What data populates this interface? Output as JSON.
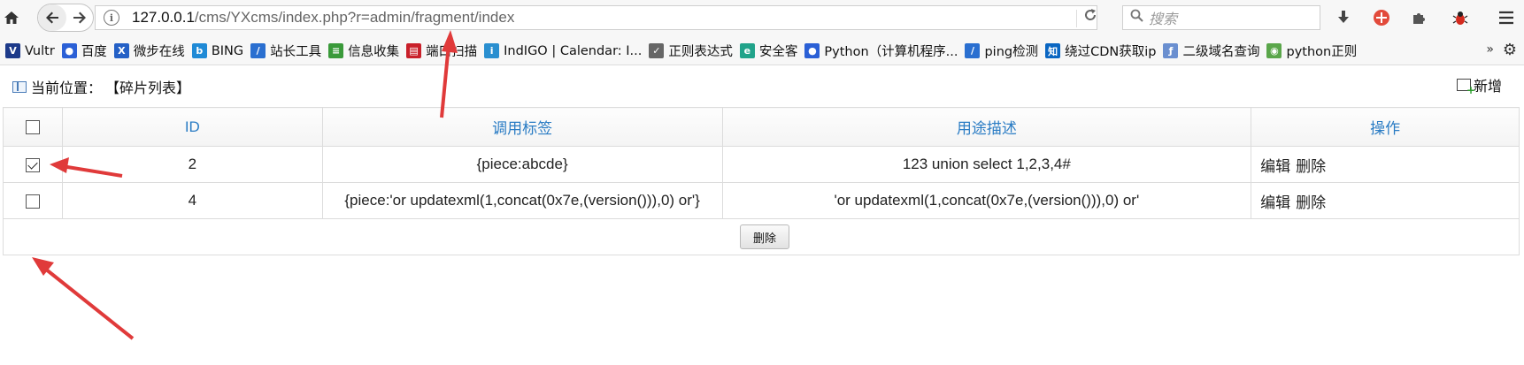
{
  "browser": {
    "url_host": "127.0.0.1",
    "url_path": "/cms/YXcms/index.php?r=admin/fragment/index",
    "search_placeholder": "搜索"
  },
  "bookmarks": [
    {
      "label": "Vultr",
      "icon": "vultr-icon",
      "icon_text": "V",
      "color": "#1d3a8a"
    },
    {
      "label": "百度",
      "icon": "baidu-paw-icon",
      "icon_text": "●",
      "color": "#2b60d6"
    },
    {
      "label": "微步在线",
      "icon": "threatbook-icon",
      "icon_text": "X",
      "color": "#2460c6"
    },
    {
      "label": "BING",
      "icon": "bing-icon",
      "icon_text": "b",
      "color": "#1f8ad6"
    },
    {
      "label": "站长工具",
      "icon": "chinaz-icon",
      "icon_text": "/",
      "color": "#2a6fd0"
    },
    {
      "label": "信息收集",
      "icon": "bars-icon",
      "icon_text": "≡",
      "color": "#3a9a3a"
    },
    {
      "label": "端口扫描",
      "icon": "port-scan-icon",
      "icon_text": "▤",
      "color": "#c9202a"
    },
    {
      "label": "IndIGO | Calendar: I...",
      "icon": "indigo-icon",
      "icon_text": "i",
      "color": "#2a8fd0"
    },
    {
      "label": "正则表达式",
      "icon": "regex-icon",
      "icon_text": "✓",
      "color": "#666666"
    },
    {
      "label": "安全客",
      "icon": "anquanke-icon",
      "icon_text": "e",
      "color": "#21a38a"
    },
    {
      "label": "Python（计算机程序...",
      "icon": "paw-icon",
      "icon_text": "●",
      "color": "#2b60d6"
    },
    {
      "label": "ping检测",
      "icon": "ping-icon",
      "icon_text": "/",
      "color": "#2a6fd0"
    },
    {
      "label": "绕过CDN获取ip",
      "icon": "zhihu-icon",
      "icon_text": "知",
      "color": "#0a66c2"
    },
    {
      "label": "二级域名查询",
      "icon": "subdomain-icon",
      "icon_text": "ƒ",
      "color": "#6a8fd0"
    },
    {
      "label": "python正则",
      "icon": "python-regex-icon",
      "icon_text": "◉",
      "color": "#5aa64a"
    }
  ],
  "page": {
    "location_label": "当前位置：",
    "location_value": "【碎片列表】",
    "new_label": "新增"
  },
  "table": {
    "headers": [
      "ID",
      "调用标签",
      "用途描述",
      "操作"
    ],
    "rows": [
      {
        "checked": true,
        "id": "2",
        "tag": "{piece:abcde}",
        "desc": "123 union select 1,2,3,4#",
        "edit": "编辑",
        "delete": "删除"
      },
      {
        "checked": false,
        "id": "4",
        "tag": "{piece:'or updatexml(1,concat(0x7e,(version())),0) or'}",
        "desc": "'or updatexml(1,concat(0x7e,(version())),0) or'",
        "edit": "编辑",
        "delete": "删除"
      }
    ],
    "bulk_delete_label": "删除"
  },
  "colors": {
    "header_text": "#2a7cc4",
    "annotation_arrow": "#e03a3a"
  }
}
